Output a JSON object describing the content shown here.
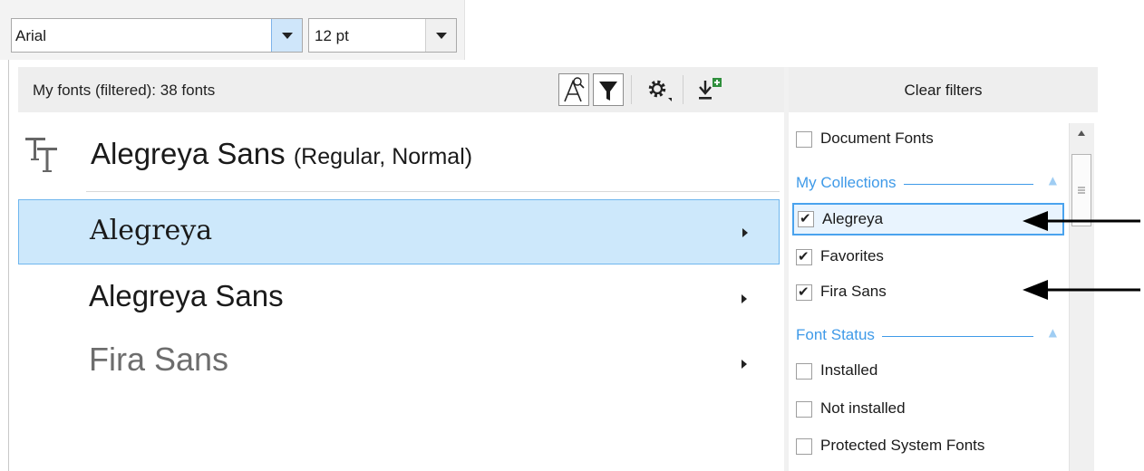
{
  "toolbar": {
    "font_name": "Arial",
    "font_size": "12 pt"
  },
  "font_list": {
    "header_count": "My fonts (filtered): 38 fonts",
    "header_icons": [
      "font-sample-icon",
      "filter-icon",
      "gear-icon",
      "download-add-icon"
    ],
    "current_font": {
      "name": "Alegreya Sans",
      "style": "(Regular, Normal)"
    },
    "rows": [
      {
        "name": "Alegreya",
        "selected": true,
        "color": "#1a1a1a"
      },
      {
        "name": "Alegreya Sans",
        "selected": false,
        "color": "#1a1a1a"
      },
      {
        "name": "Fira Sans",
        "selected": false,
        "color": "#6d6d6d"
      }
    ]
  },
  "filters": {
    "clear_label": "Clear filters",
    "document_fonts": {
      "label": "Document Fonts",
      "checked": false
    },
    "collections": {
      "title": "My Collections",
      "items": [
        {
          "label": "Alegreya",
          "checked": true
        },
        {
          "label": "Favorites",
          "checked": true
        },
        {
          "label": "Fira Sans",
          "checked": true
        }
      ]
    },
    "status": {
      "title": "Font Status",
      "items": [
        {
          "label": "Installed",
          "checked": false
        },
        {
          "label": "Not installed",
          "checked": false
        },
        {
          "label": "Protected System Fonts",
          "checked": false
        }
      ]
    }
  },
  "colors": {
    "accent": "#3f9ae8",
    "selection_bg": "#cde8fb",
    "selection_border": "#6fb6ee"
  }
}
